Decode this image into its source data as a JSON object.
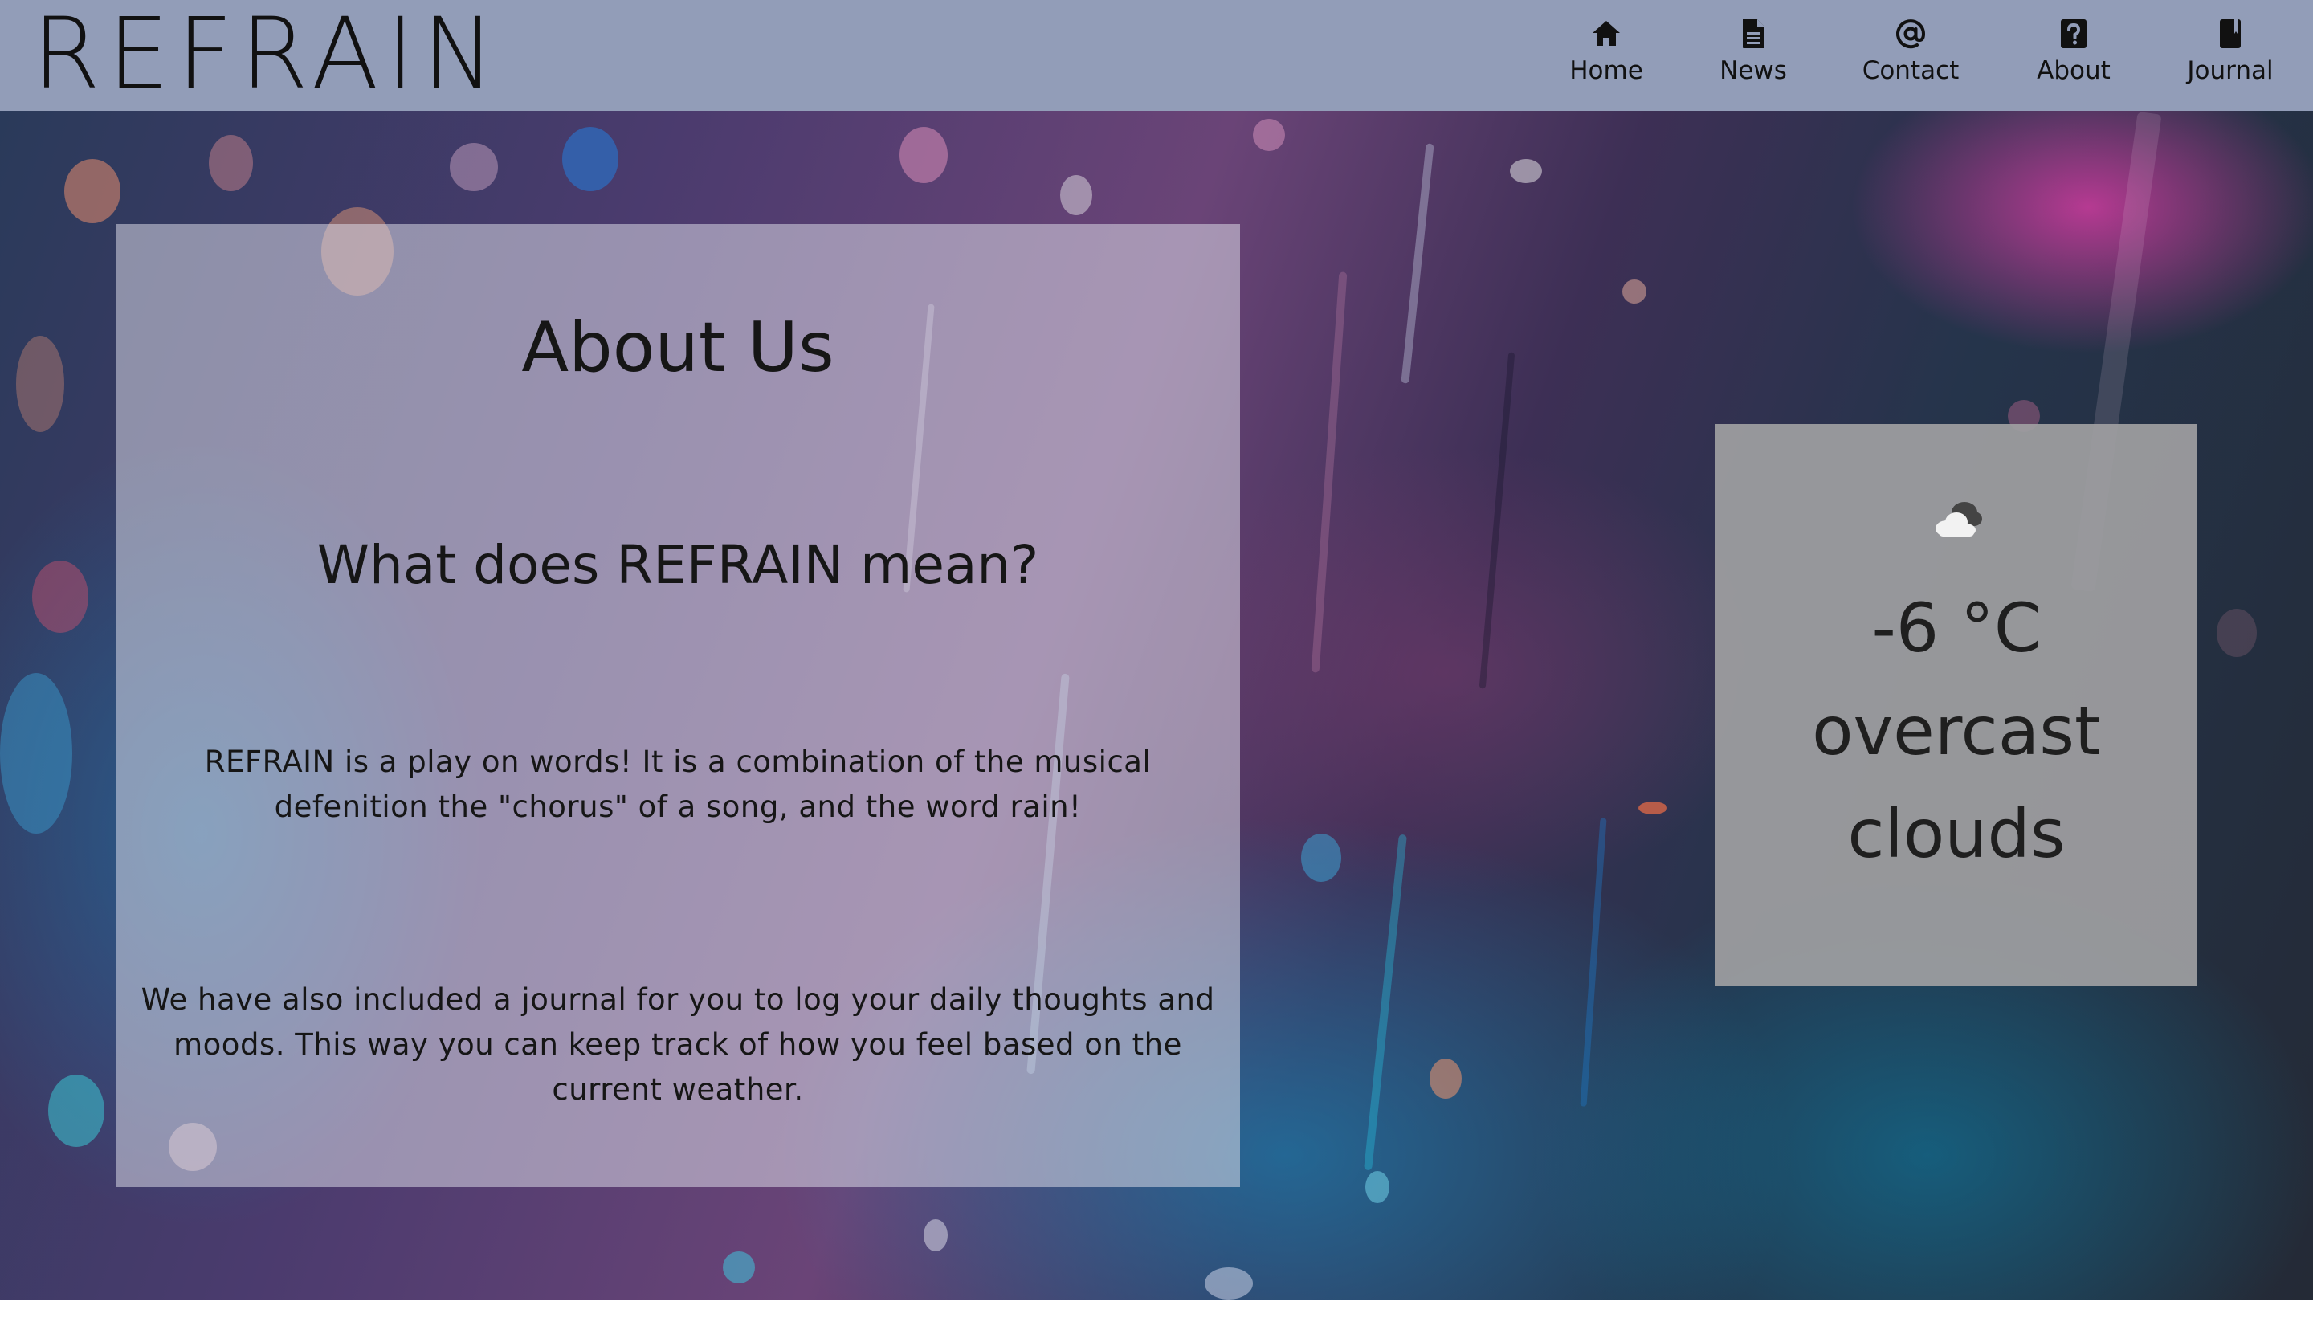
{
  "brand": {
    "logo_text": "REFRAIN"
  },
  "nav": {
    "items": [
      {
        "label": "Home",
        "icon": "home-icon"
      },
      {
        "label": "News",
        "icon": "document-icon"
      },
      {
        "label": "Contact",
        "icon": "at-sign-icon"
      },
      {
        "label": "About",
        "icon": "question-icon"
      },
      {
        "label": "Journal",
        "icon": "book-icon"
      }
    ]
  },
  "about": {
    "title": "About Us",
    "subtitle": "What does REFRAIN mean?",
    "paragraph_1": "REFRAIN is a play on words! It is a combination of the musical defenition the \"chorus\" of a song, and the word rain!",
    "paragraph_2": "We have also included a journal for you to log your daily thoughts and moods. This way you can keep track of how you feel based on the current weather."
  },
  "weather": {
    "icon": "overcast-cloud-icon",
    "temperature": "-6 °C",
    "description": "overcast clouds"
  },
  "colors": {
    "navbar": "#929db8",
    "text": "#111111"
  }
}
